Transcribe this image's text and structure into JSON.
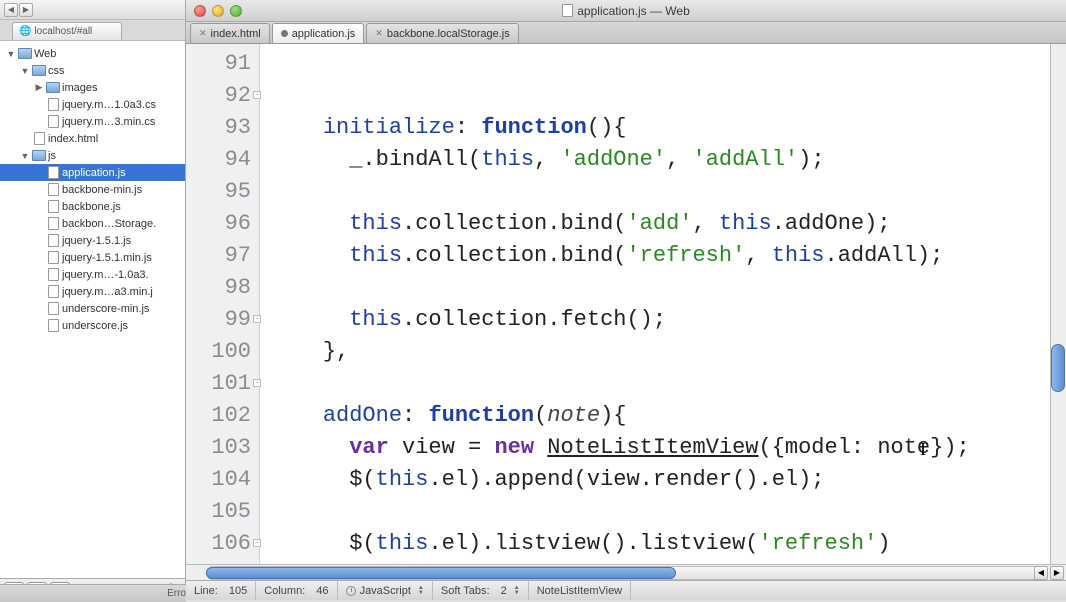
{
  "window": {
    "title": "application.js — Web",
    "title_icon": "js"
  },
  "sidebar": {
    "old_tab": "localhost/#all",
    "tree": [
      {
        "depth": 0,
        "type": "folder",
        "arrow": "down",
        "label": "Web"
      },
      {
        "depth": 1,
        "type": "folder",
        "arrow": "down",
        "label": "css"
      },
      {
        "depth": 2,
        "type": "folder",
        "arrow": "right",
        "label": "images"
      },
      {
        "depth": 2,
        "type": "file",
        "label": "jquery.m…1.0a3.cs"
      },
      {
        "depth": 2,
        "type": "file",
        "label": "jquery.m…3.min.cs"
      },
      {
        "depth": 1,
        "type": "file",
        "label": "index.html"
      },
      {
        "depth": 1,
        "type": "folder",
        "arrow": "down",
        "label": "js"
      },
      {
        "depth": 2,
        "type": "file",
        "label": "application.js",
        "selected": true
      },
      {
        "depth": 2,
        "type": "file",
        "label": "backbone-min.js"
      },
      {
        "depth": 2,
        "type": "file",
        "label": "backbone.js"
      },
      {
        "depth": 2,
        "type": "file",
        "label": "backbon…Storage."
      },
      {
        "depth": 2,
        "type": "file",
        "label": "jquery-1.5.1.js"
      },
      {
        "depth": 2,
        "type": "file",
        "label": "jquery-1.5.1.min.js"
      },
      {
        "depth": 2,
        "type": "file",
        "label": "jquery.m…-1.0a3."
      },
      {
        "depth": 2,
        "type": "file",
        "label": "jquery.m…a3.min.j"
      },
      {
        "depth": 2,
        "type": "file",
        "label": "underscore-min.js"
      },
      {
        "depth": 2,
        "type": "file",
        "label": "underscore.js"
      }
    ],
    "bottom_info": "ⓘ"
  },
  "tabs": [
    {
      "label": "index.html",
      "dirty": false,
      "active": false
    },
    {
      "label": "application.js",
      "dirty": true,
      "active": true
    },
    {
      "label": "backbone.localStorage.js",
      "dirty": false,
      "active": false
    }
  ],
  "gutter": [
    "91",
    "92",
    "93",
    "94",
    "95",
    "96",
    "97",
    "98",
    "99",
    "100",
    "101",
    "102",
    "103",
    "104",
    "105",
    "106"
  ],
  "folds": {
    "92": true,
    "99": true,
    "101": true,
    "106": true
  },
  "code": {
    "l92_initialize": "initialize",
    "l92_function": "function",
    "l93__": "_",
    "l93_bindAll": ".bindAll(",
    "l93_this": "this",
    "l93_s1": "'addOne'",
    "l93_s2": "'addAll'",
    "l95_this": "this",
    "l95_coll": ".collection.bind(",
    "l95_s": "'add'",
    "l95_this2": "this",
    "l95_addOne": ".addOne);",
    "l96_this": "this",
    "l96_coll": ".collection.bind(",
    "l96_s": "'refresh'",
    "l96_this2": "this",
    "l96_addAll": ".addAll);",
    "l98_this": "this",
    "l98_fetch": ".collection.fetch();",
    "l99_close": "},",
    "l101_addOne": "addOne",
    "l101_function": "function",
    "l101_param": "note",
    "l102_var": "var",
    "l102_view": " view = ",
    "l102_new": "new",
    "l102_ctor": "NoteListItemView",
    "l102_args": "({model: note});",
    "l103_dollar": "$(",
    "l103_this": "this",
    "l103_rest": ".el).append(view.render().el);",
    "l105_dollar": "$(",
    "l105_this": "this",
    "l105_mid": ".el).listview().listview(",
    "l105_s": "'refresh'",
    "l105_close": ")",
    "l106_close": "},"
  },
  "status": {
    "line_label": "Line:",
    "line": "105",
    "col_label": "Column:",
    "col": "46",
    "language": "JavaScript",
    "softtabs_label": "Soft Tabs:",
    "softtabs": "2",
    "symbol": "NoteListItemView"
  },
  "bottom_cut": {
    "a": "Erro"
  }
}
